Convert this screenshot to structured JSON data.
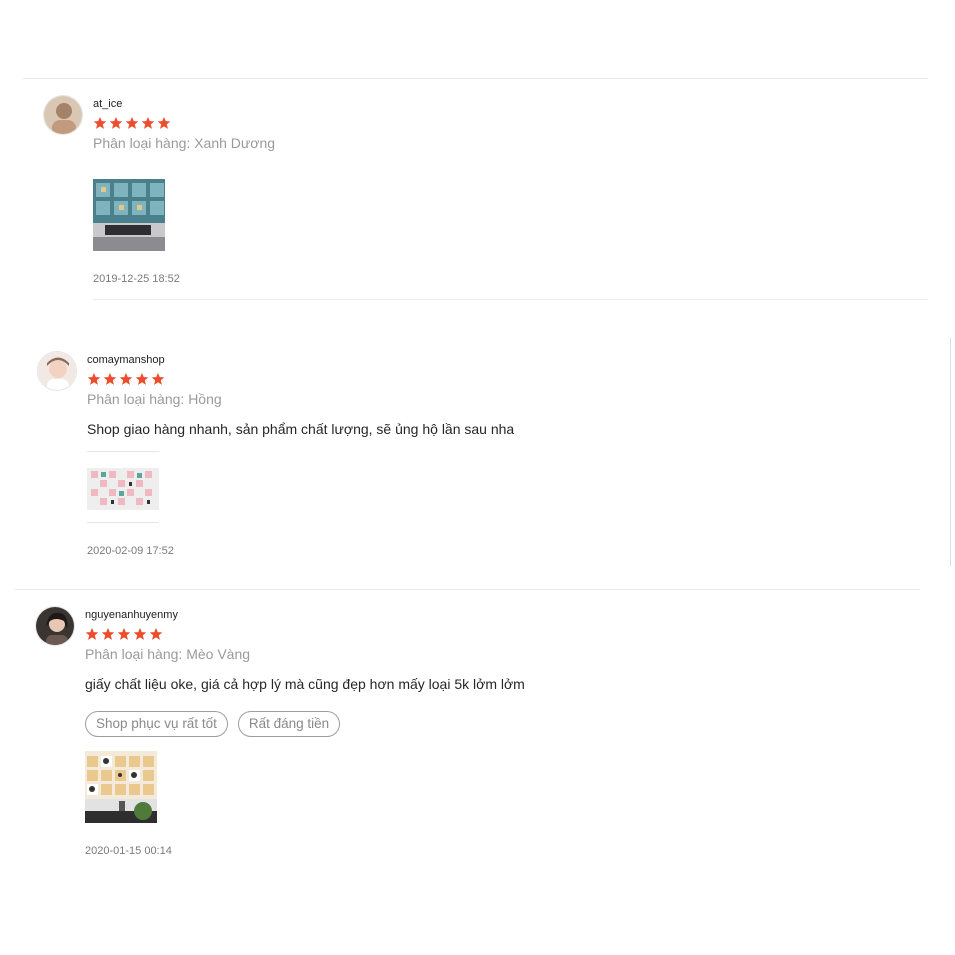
{
  "reviews": [
    {
      "username": "at_ice",
      "rating": 5,
      "variant": "Phân loại hàng: Xanh Dương",
      "comment": "",
      "tags": [],
      "date": "2019-12-25 18:52",
      "avatar_icon": "user-avatar"
    },
    {
      "username": "comaymanshop",
      "rating": 5,
      "variant": "Phân loại hàng: Hồng",
      "comment": "Shop giao hàng nhanh, sản phẩm chất lượng, sẽ ủng hộ lần sau nha",
      "tags": [],
      "date": "2020-02-09 17:52",
      "avatar_icon": "user-avatar"
    },
    {
      "username": "nguyenanhuyenmy",
      "rating": 5,
      "variant": "Phân loại hàng: Mèo Vàng",
      "comment": "giấy chất liệu oke, giá cả hợp lý mà cũng đẹp hơn mấy loại 5k lởm lởm",
      "tags": [
        "Shop phục vụ rất tốt",
        "Rất đáng tiền"
      ],
      "date": "2020-01-15 00:14",
      "avatar_icon": "user-avatar"
    }
  ],
  "colors": {
    "star": "#ee4d2d",
    "divider": "#e8e8e8",
    "muted_text": "#9a9a9a"
  }
}
